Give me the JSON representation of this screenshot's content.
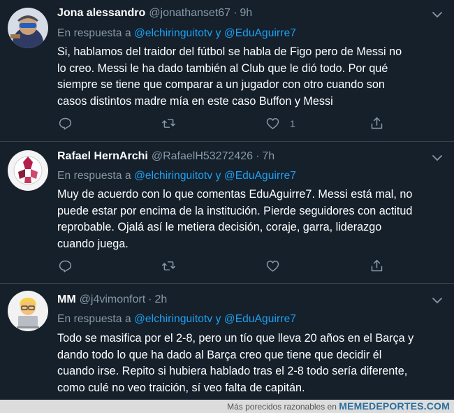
{
  "tweets": [
    {
      "name": "Jona alessandro",
      "handle": "@jonathanset67",
      "dot": "·",
      "time": "9h",
      "reply_prefix": "En respuesta a",
      "mention1": "@elchiringuitotv",
      "conj": "y",
      "mention2": "@EduAguirre7",
      "lines": [
        "Si, hablamos del traidor del fútbol se habla de Figo pero de Messi no",
        "lo creo. Messi le ha dado también al Club que le dió todo. Por qué",
        "siempre se tiene que comparar a un jugador con otro cuando son",
        "casos distintos madre mía en este caso Buffon y Messi"
      ],
      "like_count": "1"
    },
    {
      "name": "Rafael HernArchi",
      "handle": "@RafaelH53272426",
      "dot": "·",
      "time": "7h",
      "reply_prefix": "En respuesta a",
      "mention1": "@elchiringuitotv",
      "conj": "y",
      "mention2": "@EduAguirre7",
      "lines": [
        "Muy de acuerdo con lo que comentas EduAguirre7. Messi está mal, no",
        "puede estar por encima de la institución. Pierde seguidores con actitud",
        "reprobable.  Ojalá así le metiera decisión, coraje, garra, liderazgo",
        "cuando juega."
      ],
      "like_count": ""
    },
    {
      "name": "MM",
      "handle": "@j4vimonfort",
      "dot": "·",
      "time": "2h",
      "reply_prefix": "En respuesta a",
      "mention1": "@elchiringuitotv",
      "conj": "y",
      "mention2": "@EduAguirre7",
      "lines": [
        "Todo se masifica por el 2-8, pero un tío que lleva 20 años en el Barça y",
        "dando todo lo que ha dado al Barça creo que tiene que decidir él",
        "cuando irse. Repito si hubiera hablado tras el 2-8 todo sería diferente,",
        "como culé no veo traición, sí veo falta de capitán."
      ],
      "like_count": ""
    }
  ],
  "footer": {
    "caption": "Más porecidos razonables en",
    "brand": "MEMEDEPORTES.COM"
  },
  "icons": {
    "reply": "reply-icon",
    "retweet": "retweet-icon",
    "like": "like-icon",
    "share": "share-icon",
    "caret": "chevron-down-icon"
  },
  "colors": {
    "background": "#15202b",
    "muted": "#8899a6",
    "link": "#1da1f2",
    "divider": "#38444d"
  }
}
